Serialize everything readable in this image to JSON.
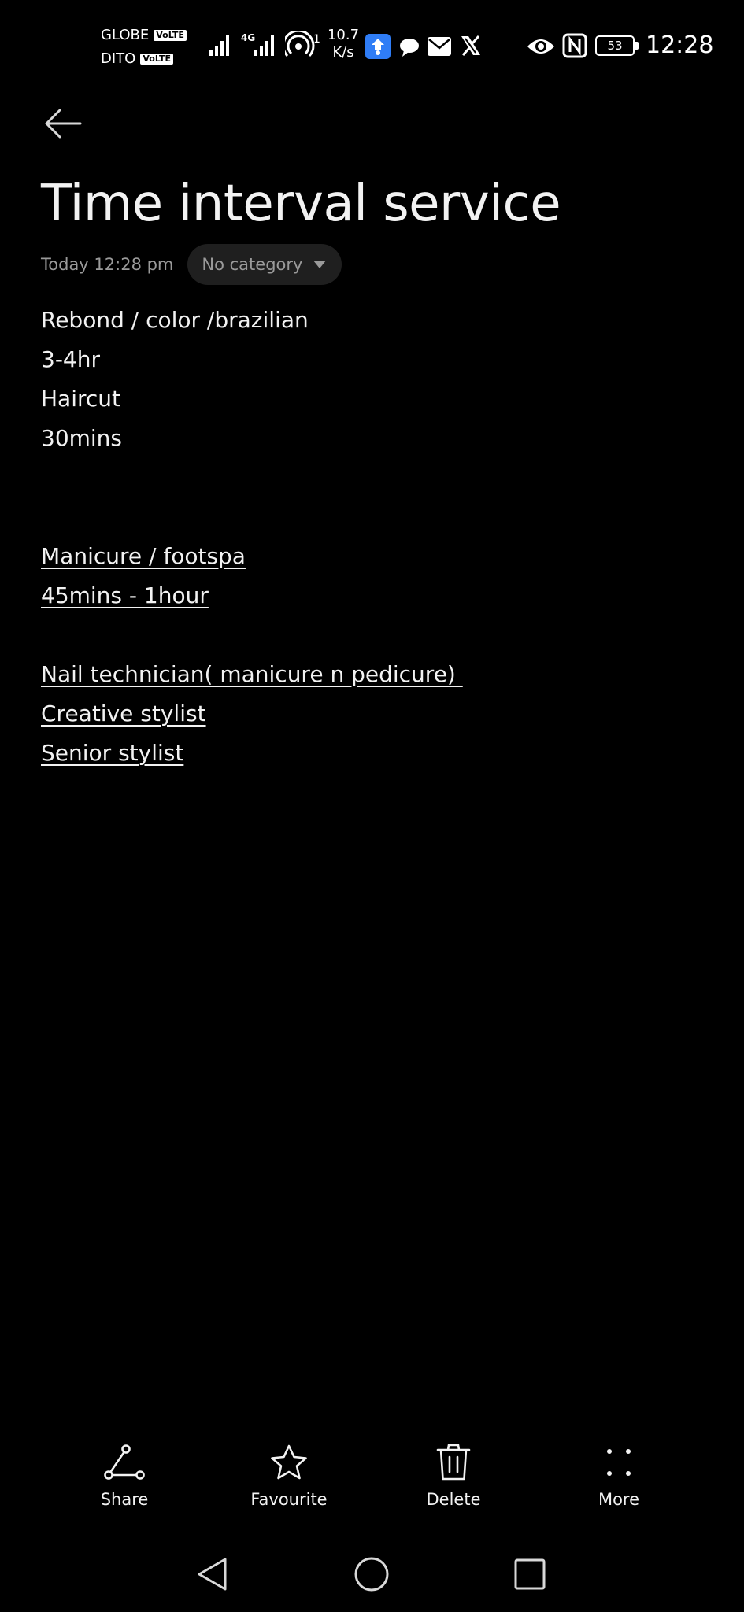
{
  "status_bar": {
    "carrier_1": "GLOBE",
    "carrier_2": "DITO",
    "volte_badge": "VoLTE",
    "network_type": "4G",
    "hotspot_count": "1",
    "speed_value": "10.7",
    "speed_unit": "K/s",
    "battery_level": "53",
    "time": "12:28",
    "icons": [
      "signal-icon",
      "signal-4g-icon",
      "hotspot-icon",
      "sync-app-icon",
      "chat-icon",
      "mail-icon",
      "x-app-icon",
      "eye-icon",
      "nfc-icon",
      "battery-icon"
    ]
  },
  "header": {
    "back_icon": "arrow-left-icon"
  },
  "note": {
    "title": "Time interval service",
    "timestamp": "Today 12:28 pm",
    "category": "No category",
    "lines": [
      {
        "text": "Rebond / color /brazilian",
        "underlined": false
      },
      {
        "text": "3-4hr",
        "underlined": false
      },
      {
        "text": "Haircut",
        "underlined": false
      },
      {
        "text": "30mins",
        "underlined": false
      },
      {
        "text": "",
        "underlined": false
      },
      {
        "text": "",
        "underlined": false
      },
      {
        "text": "Manicure / footspa",
        "underlined": true
      },
      {
        "text": "45mins - 1hour",
        "underlined": true
      },
      {
        "text": "",
        "underlined": false
      },
      {
        "text": "Nail technician( manicure n pedicure) ",
        "underlined": true
      },
      {
        "text": "Creative stylist",
        "underlined": true
      },
      {
        "text": "Senior stylist",
        "underlined": true
      }
    ]
  },
  "toolbar": {
    "share_label": "Share",
    "favourite_label": "Favourite",
    "delete_label": "Delete",
    "more_label": "More"
  },
  "colors": {
    "background": "#000000",
    "text_primary": "#f2f2f2",
    "text_secondary": "#9a9a9a",
    "pill_background": "#1f1f1f"
  }
}
